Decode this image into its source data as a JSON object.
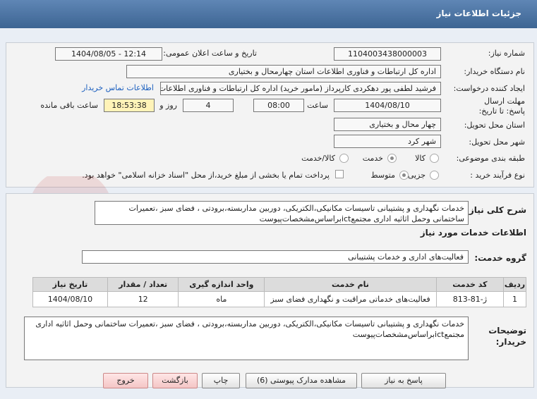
{
  "title": "جزئیات اطلاعات نیاز",
  "fields": {
    "need_number_label": "شماره نیاز:",
    "need_number": "1104003438000003",
    "announce_label": "تاریخ و ساعت اعلان عمومی:",
    "announce_value": "1404/08/05 - 12:14",
    "buyer_org_label": "نام دستگاه خریدار:",
    "buyer_org": "اداره کل ارتباطات و فناوری اطلاعات استان چهارمحال و بختیاری",
    "creator_label": "ایجاد کننده درخواست:",
    "creator": "فرشید لطفی پور دهکردی کارپرداز (مامور خرید) اداره کل ارتباطات و فناوری اطلاعات",
    "contact_link": "اطلاعات تماس خریدار",
    "deadline_label": "مهلت ارسال پاسخ: تا تاریخ:",
    "deadline_date": "1404/08/10",
    "time_label": "ساعت",
    "deadline_time": "08:00",
    "days_value": "4",
    "days_label": "روز و",
    "remaining_time": "18:53:38",
    "remaining_label": "ساعت باقی مانده",
    "province_label": "استان محل تحویل:",
    "province": "چهار محال و بختیاری",
    "city_label": "شهر محل تحویل:",
    "city": "شهر کرد",
    "category_label": "طبقه بندی موضوعی:",
    "category_options": [
      "کالا",
      "خدمت",
      "کالا/خدمت"
    ],
    "process_label": "نوع فرآیند خرید :",
    "process_options": [
      "جزیی",
      "متوسط"
    ],
    "payment_note": "پرداخت تمام یا بخشی از مبلغ خرید،از محل \"اسناد خزانه اسلامی\" خواهد بود."
  },
  "summary_label": "شرح کلی نیاز:",
  "summary_text": "خدمات نگهداری و پشتیبانی تاسیسات مکانیکی،الکتریکی، دوربین مداربسته،برودتی ، فضای سبز ،تعمیرات ساختمانی وحمل اثاثیه اداری مجتمعictبراساس‌مشخصات‌پیوست",
  "services_section": "اطلاعات خدمات مورد نیاز",
  "service_group_label": "گروه خدمت:",
  "service_group": "فعالیت‌های اداری و خدمات پشتیبانی",
  "table": {
    "headers": [
      "ردیف",
      "کد خدمت",
      "نام خدمت",
      "واحد اندازه گیری",
      "تعداد / مقدار",
      "تاریخ نیاز"
    ],
    "rows": [
      [
        "1",
        "ژ-81-813",
        "فعالیت‌های خدماتی مراقبت و نگهداری فضای سبز",
        "ماه",
        "12",
        "1404/08/10"
      ]
    ]
  },
  "buyer_notes_label": "توضیحات خریدار:",
  "buyer_notes": "خدمات نگهداری و پشتیبانی تاسیسات مکانیکی،الکتریکی، دوربین مداربسته،برودتی ، فضای سبز ،تعمیرات ساختمانی وحمل اثاثیه اداری مجتمعictبراساس‌مشخصات‌پیوست",
  "buttons": {
    "reply": "پاسخ به نیاز",
    "attachments": "مشاهده مدارک پیوستی (6)",
    "print": "چاپ",
    "back": "بازگشت",
    "exit": "خروج"
  },
  "watermark": "AriaTender.net",
  "colors": {
    "header": "#4a72a2",
    "link": "#1b5fbf",
    "timer_bg": "#fff3b8",
    "pink_button": "#f4c6c6"
  }
}
